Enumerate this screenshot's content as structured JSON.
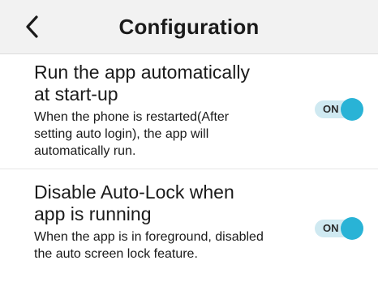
{
  "header": {
    "title": "Configuration",
    "back_icon": "chevron-left-icon"
  },
  "settings": [
    {
      "title": "Run the app automatically at start-up",
      "description": "When the phone is restarted(After setting auto login), the app will automatically run.",
      "toggle_label": "ON",
      "enabled": true
    },
    {
      "title": "Disable Auto-Lock when app is running",
      "description": "When the app is in foreground, disabled the auto screen lock feature.",
      "toggle_label": "ON",
      "enabled": true
    }
  ],
  "colors": {
    "accent": "#29b3d6",
    "toggle_track": "#cfe9f1",
    "header_bg": "#f2f2f2"
  }
}
